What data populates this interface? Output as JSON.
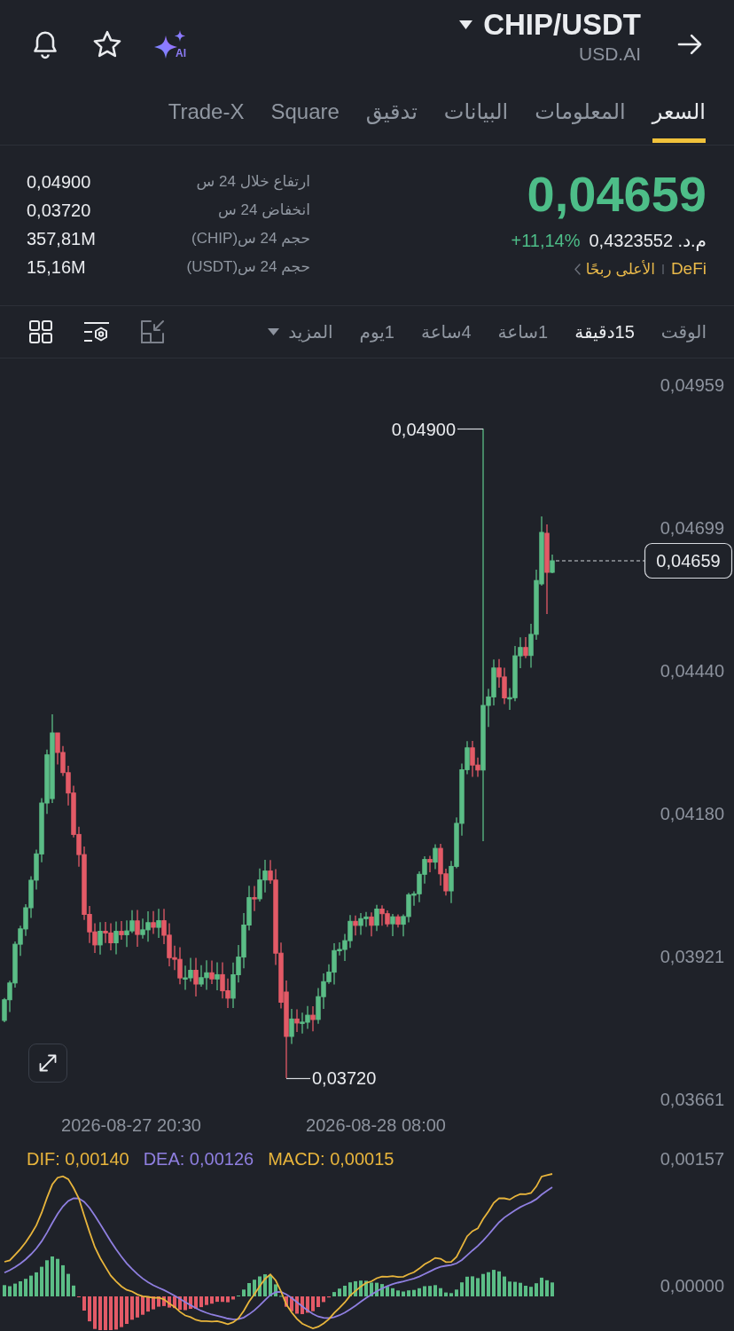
{
  "header": {
    "pair": "CHIP/USDT",
    "subtitle": "USD.AI",
    "ai_label": "AI"
  },
  "tabs": [
    {
      "label": "السعر",
      "selected": true
    },
    {
      "label": "المعلومات",
      "selected": false
    },
    {
      "label": "البيانات",
      "selected": false
    },
    {
      "label": "تدقيق",
      "selected": false
    },
    {
      "label": "Square",
      "selected": false
    },
    {
      "label": "Trade-X",
      "selected": false
    }
  ],
  "ticker": {
    "price": "0,04659",
    "fiat_price": "م.د. 0,4323552",
    "change": "+11,14%",
    "category": "DeFi",
    "ranking": "الأعلى ربحًا"
  },
  "stats": [
    {
      "label": "ارتفاع خلال 24 س",
      "value": "0,04900"
    },
    {
      "label": "انخفاض 24 س",
      "value": "0,03720"
    },
    {
      "label": "حجم 24 س(CHIP)",
      "value": "357,81M"
    },
    {
      "label": "حجم 24 س(USDT)",
      "value": "15,16M"
    }
  ],
  "timeframes": [
    {
      "label": "الوقت",
      "kind": "interval",
      "selected": false
    },
    {
      "label": "15دقيقة",
      "kind": "interval",
      "selected": true
    },
    {
      "label": "1ساعة",
      "kind": "interval",
      "selected": false
    },
    {
      "label": "4ساعة",
      "kind": "interval",
      "selected": false
    },
    {
      "label": "1يوم",
      "kind": "interval",
      "selected": false
    },
    {
      "label": "المزيد",
      "kind": "dropdown",
      "selected": false
    }
  ],
  "chart": {
    "price_axis": [
      "0,04959",
      "0,04699",
      "0,04440",
      "0,04180",
      "0,03921",
      "0,03661"
    ],
    "high_label": "0,04900",
    "low_label": "0,03720",
    "last_price": "0,04659",
    "time_axis": [
      "2026-08-28 08:00",
      "2026-08-27 20:30"
    ]
  },
  "macd": {
    "dif": "DIF: 0,00140",
    "dea": "DEA: 0,00126",
    "macd": "MACD: 0,00015",
    "axis": [
      "0,00157",
      "0,00000"
    ]
  }
}
